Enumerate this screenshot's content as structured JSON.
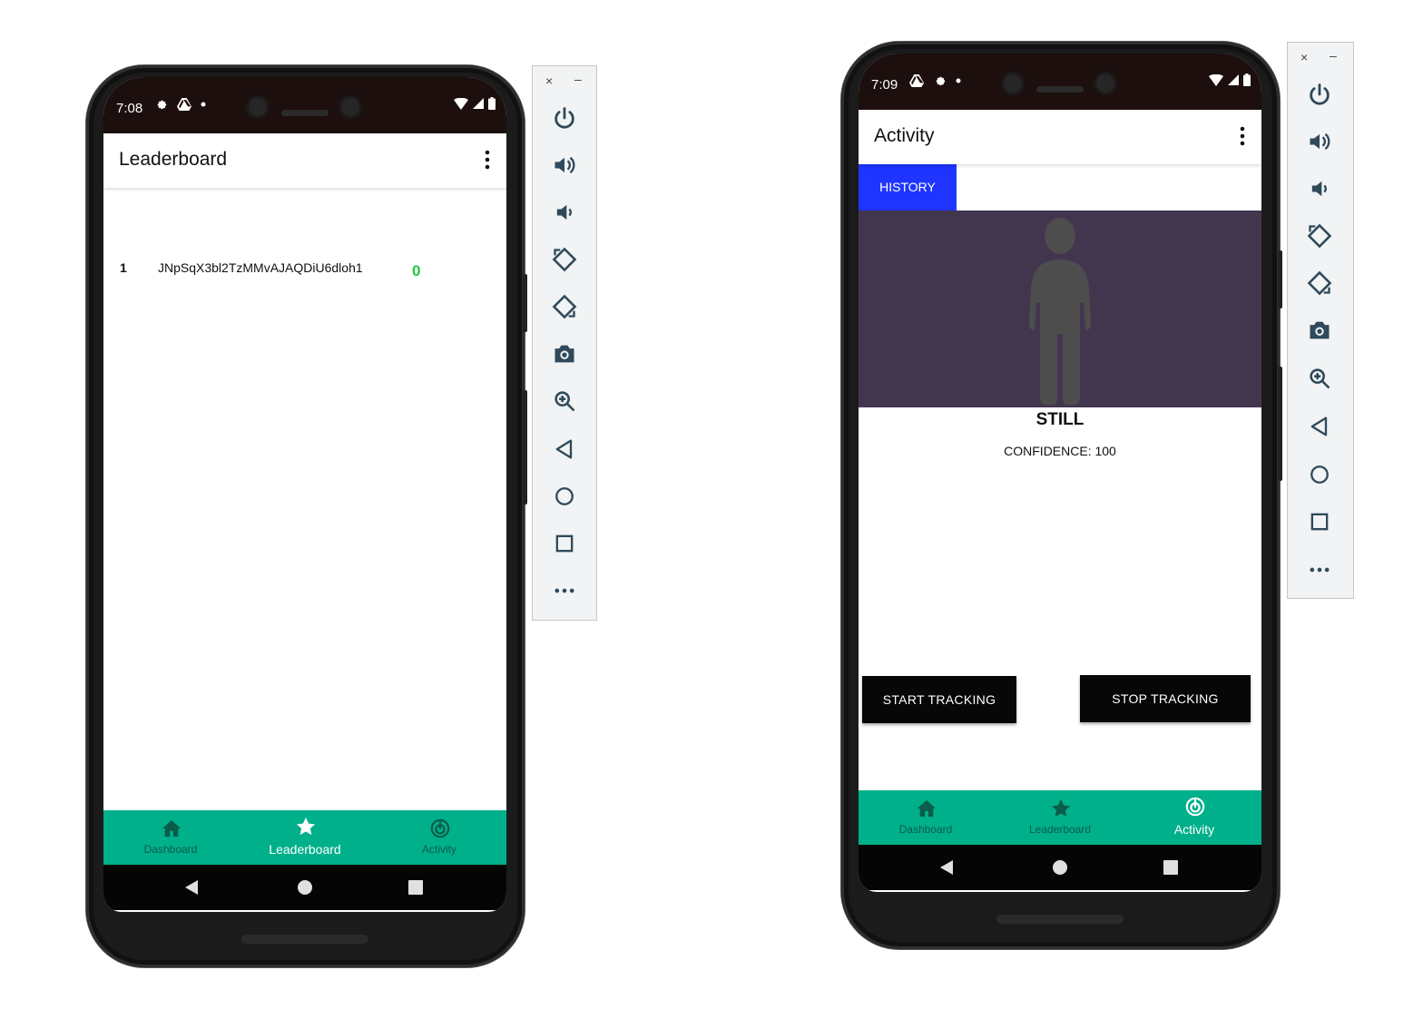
{
  "left_device": {
    "status": {
      "time": "7:08",
      "icons": [
        "gear-icon",
        "drive-icon",
        "dot-icon"
      ],
      "right_icons": [
        "wifi-icon",
        "signal-icon",
        "battery-icon"
      ]
    },
    "app_bar": {
      "title": "Leaderboard",
      "menu_icon": "more-vert-icon"
    },
    "leaderboard": {
      "rows": [
        {
          "rank": "1",
          "name": "JNpSqX3bl2TzMMvAJAQDiU6dloh1",
          "score": "0"
        }
      ]
    },
    "bottom_nav": {
      "tabs": [
        {
          "label": "Dashboard",
          "icon": "home-icon",
          "active": false
        },
        {
          "label": "Leaderboard",
          "icon": "star-icon",
          "active": true
        },
        {
          "label": "Activity",
          "icon": "activity-icon",
          "active": false
        }
      ]
    },
    "system_nav": [
      "back-icon",
      "home-circle-icon",
      "recents-icon"
    ]
  },
  "right_device": {
    "status": {
      "time": "7:09",
      "icons": [
        "drive-icon",
        "gear-icon",
        "dot-icon"
      ],
      "right_icons": [
        "wifi-icon",
        "signal-icon",
        "battery-icon"
      ]
    },
    "app_bar": {
      "title": "Activity",
      "menu_icon": "more-vert-icon"
    },
    "history_button": "HISTORY",
    "activity": {
      "state": "STILL",
      "confidence": "CONFIDENCE: 100",
      "image_icon": "standing-person-icon"
    },
    "start_button": "START TRACKING",
    "stop_button": "STOP TRACKING",
    "bottom_nav": {
      "tabs": [
        {
          "label": "Dashboard",
          "icon": "home-icon",
          "active": false
        },
        {
          "label": "Leaderboard",
          "icon": "star-icon",
          "active": false
        },
        {
          "label": "Activity",
          "icon": "activity-icon",
          "active": true
        }
      ]
    },
    "system_nav": [
      "back-icon",
      "home-circle-icon",
      "recents-icon"
    ]
  },
  "emulator_toolbar": {
    "close": "×",
    "minimize": "–",
    "tools": [
      "power-icon",
      "volume-up-icon",
      "volume-down-icon",
      "rotate-left-icon",
      "rotate-right-icon",
      "camera-icon",
      "zoom-icon",
      "back-icon",
      "home-icon",
      "overview-icon",
      "more-icon"
    ]
  },
  "colors": {
    "accent_nav": "#00b08a",
    "history_blue": "#1f35ff",
    "banner_purple": "#42364f",
    "score_green": "#1fc73a",
    "status_bar": "#1c0f0d"
  }
}
